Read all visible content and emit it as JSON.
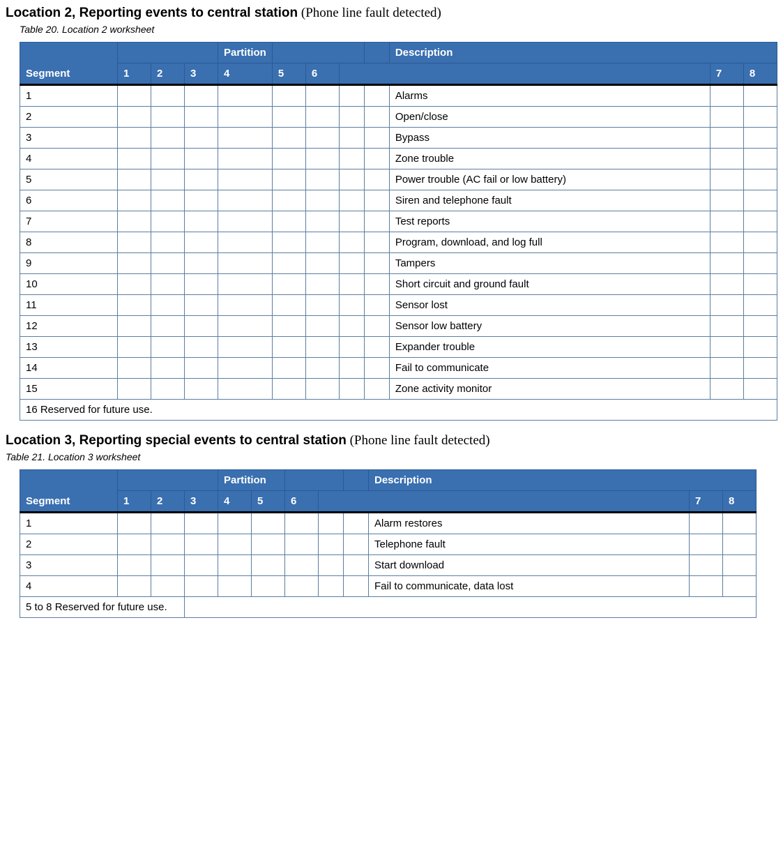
{
  "section1": {
    "heading_bold": "Location 2, Reporting events to central station",
    "heading_suffix": " (Phone line fault detected)",
    "caption": "Table 20. Location 2 worksheet"
  },
  "section2": {
    "heading_bold": "Location 3, Reporting special events to central station",
    "heading_suffix": " (Phone line fault detected)",
    "caption": "Table 21. Location 3 worksheet"
  },
  "headers": {
    "segment": "Segment",
    "partition": "Partition",
    "description": "Description",
    "p1": "1",
    "p2": "2",
    "p3": "3",
    "p4": "4",
    "p5": "5",
    "p6": "6",
    "p7": "7",
    "p8": "8"
  },
  "table20_rows": [
    {
      "seg": "1",
      "desc": "Alarms"
    },
    {
      "seg": "2",
      "desc": "Open/close"
    },
    {
      "seg": "3",
      "desc": "Bypass"
    },
    {
      "seg": "4",
      "desc": "Zone trouble"
    },
    {
      "seg": "5",
      "desc": "Power trouble (AC fail or low battery)"
    },
    {
      "seg": "6",
      "desc": "Siren and telephone fault"
    },
    {
      "seg": "7",
      "desc": "Test reports"
    },
    {
      "seg": "8",
      "desc": "Program, download, and log full"
    },
    {
      "seg": "9",
      "desc": "Tampers"
    },
    {
      "seg": "10",
      "desc": "Short circuit and ground fault"
    },
    {
      "seg": "11",
      "desc": "Sensor lost"
    },
    {
      "seg": "12",
      "desc": "Sensor low battery"
    },
    {
      "seg": "13",
      "desc": "Expander trouble"
    },
    {
      "seg": "14",
      "desc": "Fail to communicate"
    },
    {
      "seg": "15",
      "desc": "Zone activity monitor"
    }
  ],
  "table20_reserved": "16  Reserved for future use.",
  "table21_rows": [
    {
      "seg": "1",
      "desc": "Alarm restores"
    },
    {
      "seg": "2",
      "desc": "Telephone fault"
    },
    {
      "seg": "3",
      "desc": "Start download"
    },
    {
      "seg": "4",
      "desc": "Fail to communicate, data lost"
    }
  ],
  "table21_reserved": "5 to 8 Reserved for future use."
}
